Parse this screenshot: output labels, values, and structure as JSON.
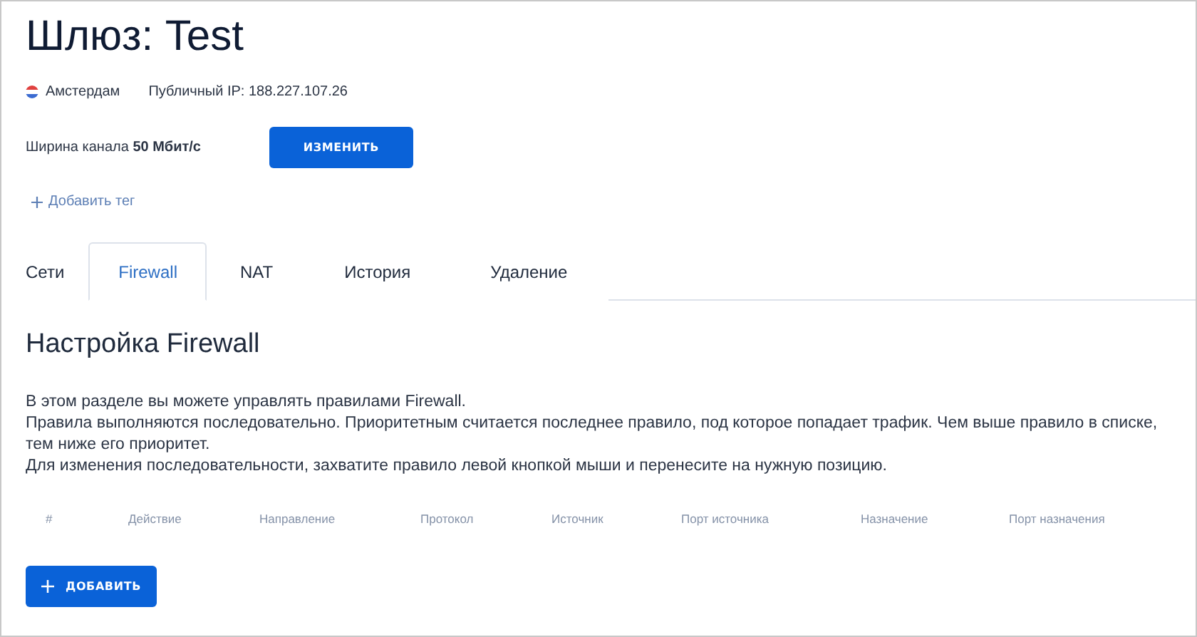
{
  "title": "Шлюз: Test",
  "location": "Амстердам",
  "public_ip": "Публичный IP: 188.227.107.26",
  "bandwidth": "Ширина канала **50 Мбит/с**",
  "change_button": "ИЗМЕНИТЬ",
  "add_tag": "Добавить тег",
  "tabs": [
    {
      "label": "Сети",
      "selected": false
    },
    {
      "label": "Firewall",
      "selected": true
    },
    {
      "label": "NAT",
      "selected": false
    },
    {
      "label": "История",
      "selected": false
    },
    {
      "label": "Удаление",
      "selected": false
    }
  ],
  "section_title": "Настройка Firewall",
  "description": [
    "В этом разделе вы можете управлять правилами Firewall.",
    "Правила выполняются последовательно. Приоритетным считается последнее правило, под которое попадает трафик. Чем выше правило в списке, тем ниже его приоритет.",
    "Для изменения последовательности, захватите правило левой кнопкой мыши и перенесите на нужную позицию."
  ],
  "table": {
    "columns": [
      "#",
      "Действие",
      "Направление",
      "Протокол",
      "Источник",
      "Порт источника",
      "Назначение",
      "Порт назначения"
    ]
  },
  "add_button": "ДОБАВИТЬ"
}
